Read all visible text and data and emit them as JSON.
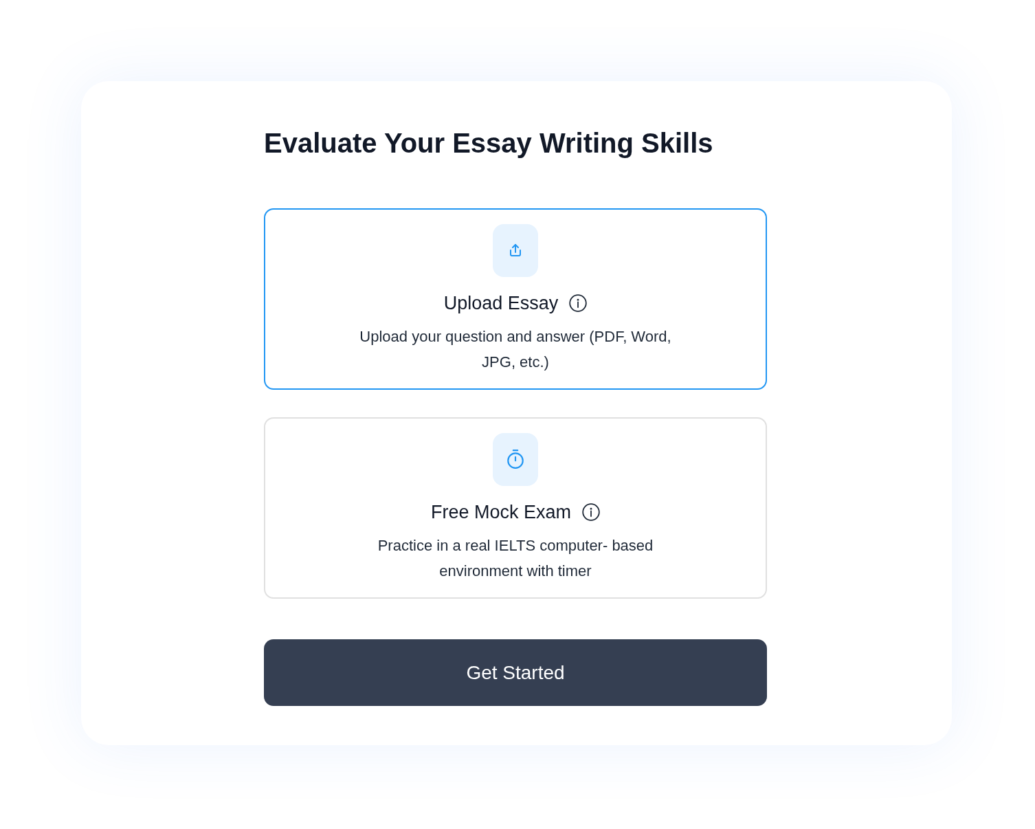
{
  "heading": "Evaluate Your Essay Writing Skills",
  "options": [
    {
      "kind": "upload",
      "title": "Upload Essay",
      "description": "Upload your question and answer (PDF, Word, JPG, etc.)",
      "selected": true
    },
    {
      "kind": "timer",
      "title": "Free Mock Exam",
      "description": "Practice in a real IELTS computer- based environment with timer",
      "selected": false
    }
  ],
  "button": {
    "label": "Get Started"
  }
}
